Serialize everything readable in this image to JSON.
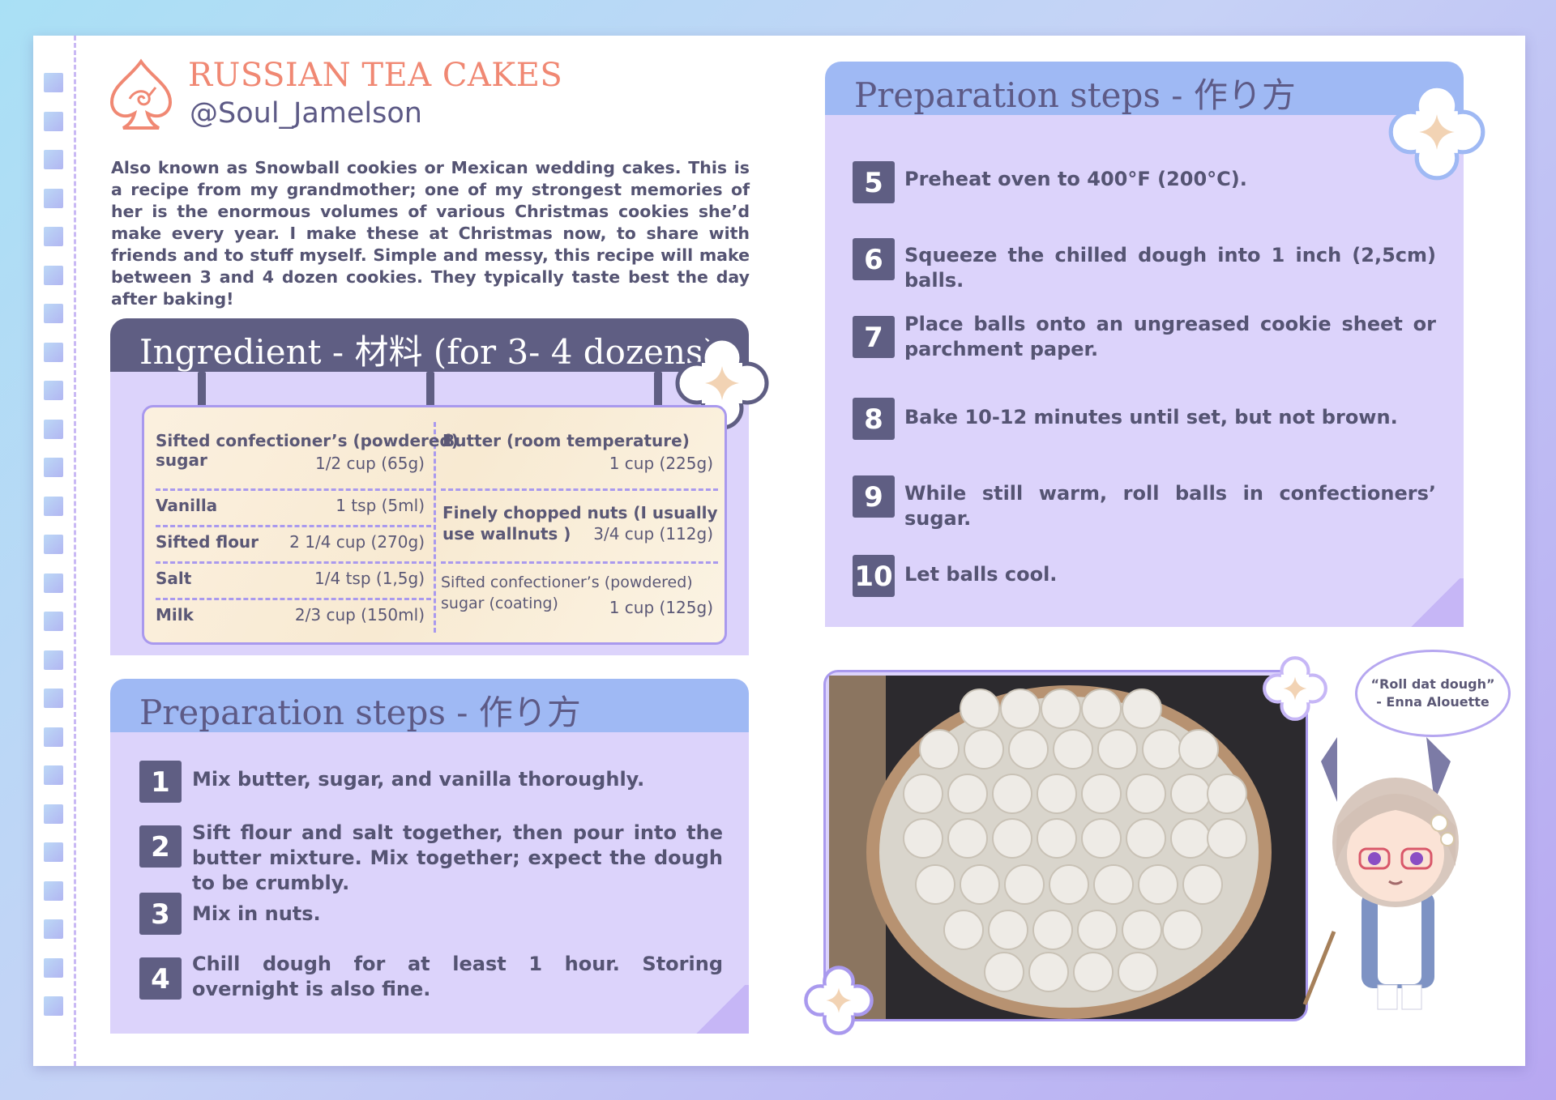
{
  "header": {
    "title": "RUSSIAN TEA CAKES",
    "author": "@Soul_Jamelson"
  },
  "intro": "Also known as Snowball cookies or Mexican wedding cakes. This is a recipe from my grandmother; one of my strongest memories of her is the enormous volumes of various Christmas cookies she’d make every year. I make these at Christmas now, to share with friends and to stuff myself. Simple and messy, this recipe will make between 3 and 4 dozen cookies. They typically taste best the day after baking!",
  "ingredients": {
    "heading": "Ingredient - 材料 (for 3- 4 dozens)",
    "left": [
      {
        "name": "Sifted confectioner’s (powdered)",
        "name2": "sugar",
        "amount": "1/2 cup (65g)"
      },
      {
        "name": "Vanilla",
        "amount": "1 tsp (5ml)"
      },
      {
        "name": "Sifted flour",
        "amount": "2 1/4 cup (270g)"
      },
      {
        "name": "Salt",
        "amount": "1/4 tsp (1,5g)"
      },
      {
        "name": "Milk",
        "amount": "2/3 cup (150ml)"
      }
    ],
    "right": [
      {
        "name": "Butter (room temperature)",
        "amount": "1 cup (225g)"
      },
      {
        "name": "Finely chopped nuts (I usually",
        "name2": "use wallnuts )",
        "amount": "3/4 cup (112g)"
      },
      {
        "name": "Sifted confectioner’s (powdered)",
        "name2": "sugar (coating)",
        "amount": "1 cup (125g)"
      }
    ]
  },
  "prep_left": {
    "heading": "Preparation steps - 作り方",
    "steps": [
      {
        "num": "1",
        "text": "Mix butter, sugar, and vanilla thoroughly."
      },
      {
        "num": "2",
        "text": "Sift flour and salt together, then pour into the butter mixture. Mix together; expect the dough to be crumbly."
      },
      {
        "num": "3",
        "text": "Mix in nuts."
      },
      {
        "num": "4",
        "text": "Chill dough for at least 1 hour. Storing overnight is also fine."
      }
    ]
  },
  "prep_right": {
    "heading": "Preparation steps - 作り方",
    "steps": [
      {
        "num": "5",
        "text": "Preheat oven to 400°F (200°C)."
      },
      {
        "num": "6",
        "text": "Squeeze the chilled dough into 1 inch (2,5cm) balls."
      },
      {
        "num": "7",
        "text": "Place balls onto an ungreased cookie sheet or parchment paper."
      },
      {
        "num": "8",
        "text": "Bake 10-12 minutes until set, but not brown."
      },
      {
        "num": "9",
        "text": "While still warm, roll balls in confectioners’ sugar."
      },
      {
        "num": "10",
        "text": "Let balls cool."
      }
    ]
  },
  "bubble": {
    "quote": "“Roll dat dough”",
    "attribution": "- Enna Alouette"
  },
  "colors": {
    "title": "#f08873",
    "panel": "#dcd3fb",
    "header_dark": "#5f5e83",
    "header_blue": "#9fb9f4",
    "text": "#555473"
  }
}
